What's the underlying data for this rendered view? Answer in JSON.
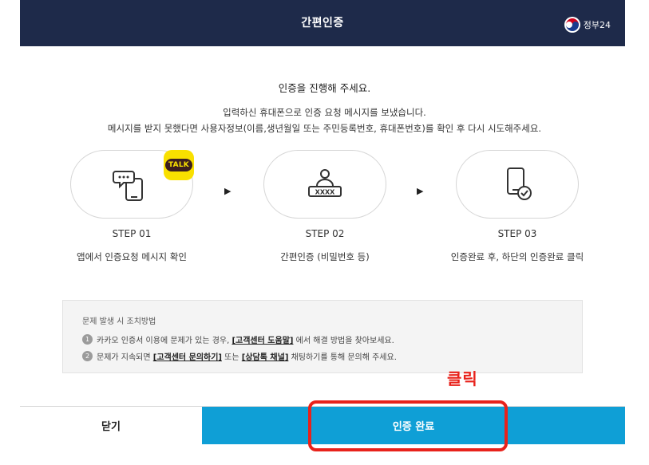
{
  "header": {
    "title": "간편인증",
    "gov_logo_text": "정부24"
  },
  "intro": {
    "title": "인증을 진행해 주세요.",
    "line1": "입력하신 휴대폰으로 인증 요청 메시지를 보냈습니다.",
    "line2": "메시지를 받지 못했다면 사용자정보(이름,생년월일 또는 주민등록번호, 휴대폰번호)를 확인 후 다시 시도해주세요."
  },
  "steps": [
    {
      "label": "STEP 01",
      "desc": "앱에서 인증요청 메시지 확인",
      "icon": "phone-message-icon",
      "badge": "TALK"
    },
    {
      "label": "STEP 02",
      "desc": "간편인증 (비밀번호 등)",
      "icon": "user-password-icon",
      "password_mask": "XXXX"
    },
    {
      "label": "STEP 03",
      "desc": "인증완료 후, 하단의 인증완료 클릭",
      "icon": "phone-check-icon"
    }
  ],
  "arrow_glyph": "▶",
  "help": {
    "title": "문제 발생 시 조치방법",
    "items": [
      {
        "num": "1",
        "pre": "카카오 인증서 이용에 문제가 있는 경우, ",
        "link1": "[고객센터 도움말]",
        "post": " 에서 해결 방법을 찾아보세요."
      },
      {
        "num": "2",
        "pre": "문제가 지속되면 ",
        "link1": "[고객센터 문의하기]",
        "mid": " 또는 ",
        "link2": "[상담톡 채널]",
        "post": " 채팅하기를 통해 문의해 주세요."
      }
    ]
  },
  "annotation": {
    "click_label": "클릭",
    "color": "#e8221b"
  },
  "buttons": {
    "close_label": "닫기",
    "complete_label": "인증 완료"
  },
  "colors": {
    "header_bg": "#1e2a4a",
    "complete_bg": "#0f9fd6",
    "talk_yellow": "#f9e000"
  }
}
